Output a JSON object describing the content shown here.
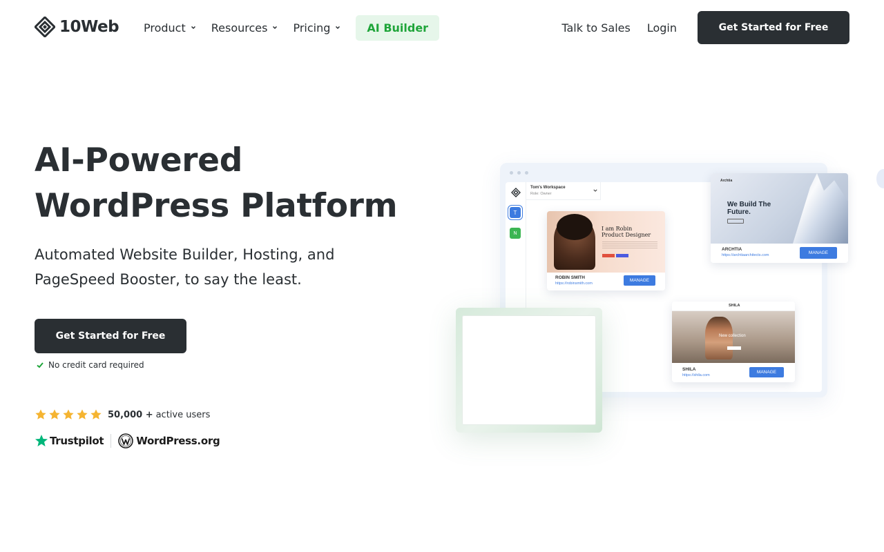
{
  "nav": {
    "logo_text": "10Web",
    "items": [
      {
        "label": "Product"
      },
      {
        "label": "Resources"
      },
      {
        "label": "Pricing"
      }
    ],
    "ai_builder": "AI Builder",
    "talk_to_sales": "Talk to Sales",
    "login": "Login",
    "cta": "Get Started for Free"
  },
  "hero": {
    "title_line1": "AI-Powered",
    "title_line2": "WordPress Platform",
    "subtitle": "Automated Website Builder, Hosting, and PageSpeed Booster, to say the least.",
    "cta": "Get Started for Free",
    "no_card": "No credit card required",
    "rating": {
      "stars": 5,
      "count": "50,000 +",
      "label": "active users"
    },
    "badges": {
      "trustpilot": "Trustpilot",
      "wordpress": "WordPress.org"
    }
  },
  "illustration": {
    "workspace_name": "Tom's Workspace",
    "workspace_role": "Role: Owner",
    "avatars": [
      "T",
      "N"
    ],
    "robin": {
      "greeting_line1": "I am Robin",
      "greeting_line2": "Product Designer",
      "name": "ROBIN SMITH",
      "url": "https://robinsmith.com",
      "manage": "MANAGE"
    },
    "archtia": {
      "logo": "Archtia",
      "headline_line1": "We Build The",
      "headline_line2": "Future.",
      "name": "ARCHTIA",
      "url": "https://archtiaarchitects.com",
      "manage": "MANAGE"
    },
    "shila": {
      "logo": "SHILA",
      "caption": "New collection",
      "name": "SHILA",
      "url": "https://shila.com",
      "manage": "MANAGE"
    }
  },
  "colors": {
    "dark": "#2a2f33",
    "accent_green": "#1fa53a",
    "star": "#f5b431",
    "manage_blue": "#3d7be0",
    "trustpilot_green": "#00b67a"
  }
}
